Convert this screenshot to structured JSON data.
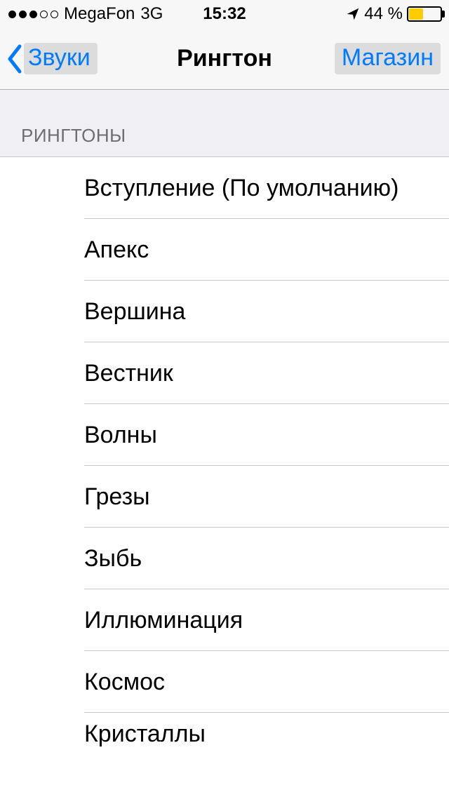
{
  "status": {
    "carrier": "MegaFon",
    "network": "3G",
    "time": "15:32",
    "battery_text": "44 %",
    "battery_level_percent": 44
  },
  "nav": {
    "back_label": "Звуки",
    "title": "Рингтон",
    "right_label": "Магазин"
  },
  "section": {
    "header": "РИНГТОНЫ"
  },
  "ringtones": [
    "Вступление (По умолчанию)",
    "Апекс",
    "Вершина",
    "Вестник",
    "Волны",
    "Грезы",
    "Зыбь",
    "Иллюминация",
    "Космос",
    "Кристаллы"
  ]
}
